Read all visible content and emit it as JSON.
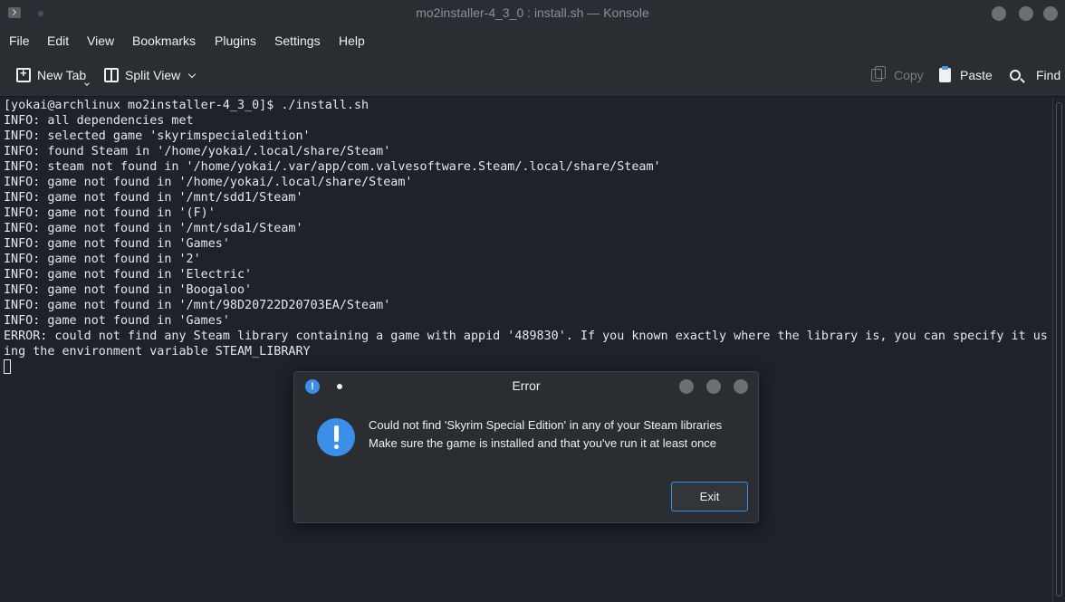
{
  "window": {
    "title": "mo2installer-4_3_0 : install.sh — Konsole"
  },
  "menu": {
    "items": [
      "File",
      "Edit",
      "View",
      "Bookmarks",
      "Plugins",
      "Settings",
      "Help"
    ]
  },
  "toolbar": {
    "new_tab": "New Tab",
    "split_view": "Split View",
    "copy": "Copy",
    "paste": "Paste",
    "find": "Find"
  },
  "terminal": {
    "lines": [
      "[yokai@archlinux mo2installer-4_3_0]$ ./install.sh",
      "INFO: all dependencies met",
      "INFO: selected game 'skyrimspecialedition'",
      "INFO: found Steam in '/home/yokai/.local/share/Steam'",
      "INFO: steam not found in '/home/yokai/.var/app/com.valvesoftware.Steam/.local/share/Steam'",
      "INFO: game not found in '/home/yokai/.local/share/Steam'",
      "INFO: game not found in '/mnt/sdd1/Steam'",
      "INFO: game not found in '(F)'",
      "INFO: game not found in '/mnt/sda1/Steam'",
      "INFO: game not found in 'Games'",
      "INFO: game not found in '2'",
      "INFO: game not found in 'Electric'",
      "INFO: game not found in 'Boogaloo'",
      "INFO: game not found in '/mnt/98D20722D20703EA/Steam'",
      "INFO: game not found in 'Games'",
      "ERROR: could not find any Steam library containing a game with appid '489830'. If you known exactly where the library is, you can specify it us",
      "ing the environment variable STEAM_LIBRARY"
    ]
  },
  "dialog": {
    "title": "Error",
    "message_line1": "Could not find 'Skyrim Special Edition' in any of your Steam libraries",
    "message_line2": "Make sure the game is installed and that you've run it at least once",
    "exit_label": "Exit"
  }
}
